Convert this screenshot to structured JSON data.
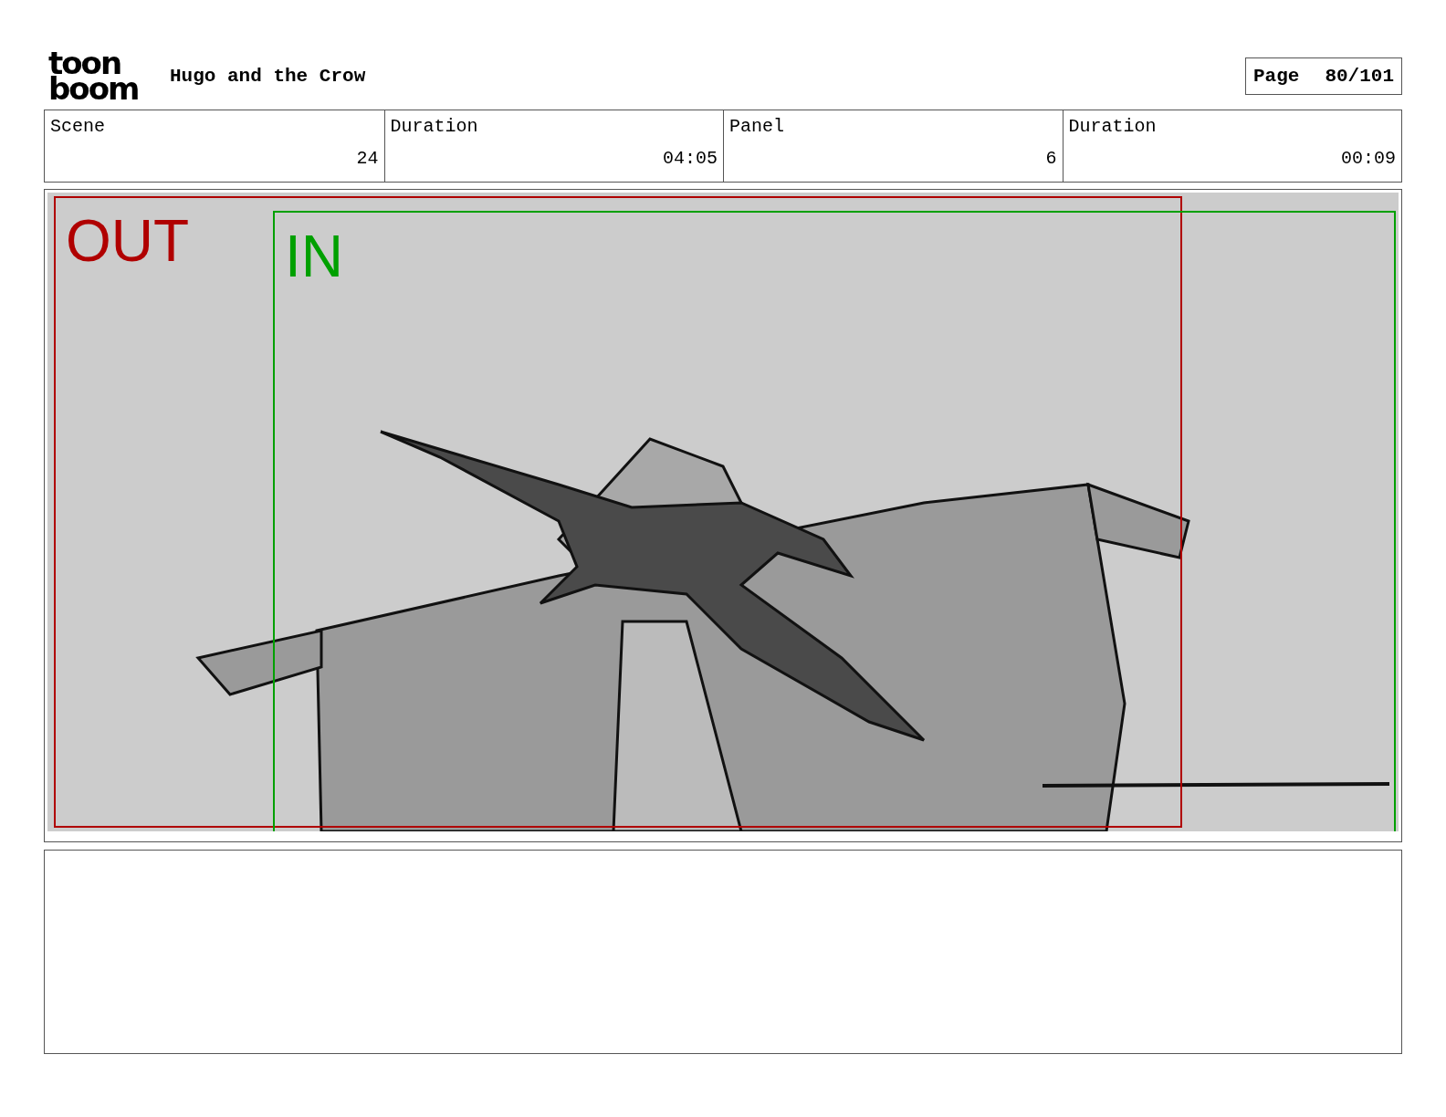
{
  "logo": {
    "lines": [
      "toon",
      "boom"
    ]
  },
  "title": "Hugo and the Crow",
  "page": {
    "label": "Page",
    "value": "80/101"
  },
  "info_table": {
    "columns": [
      "Scene",
      "Duration",
      "Panel",
      "Duration"
    ],
    "values": [
      "24",
      "04:05",
      "6",
      "00:09"
    ]
  },
  "panel": {
    "frames": [
      {
        "label": "OUT",
        "color": "#b00000"
      },
      {
        "label": "IN",
        "color": "#00a000"
      }
    ]
  }
}
